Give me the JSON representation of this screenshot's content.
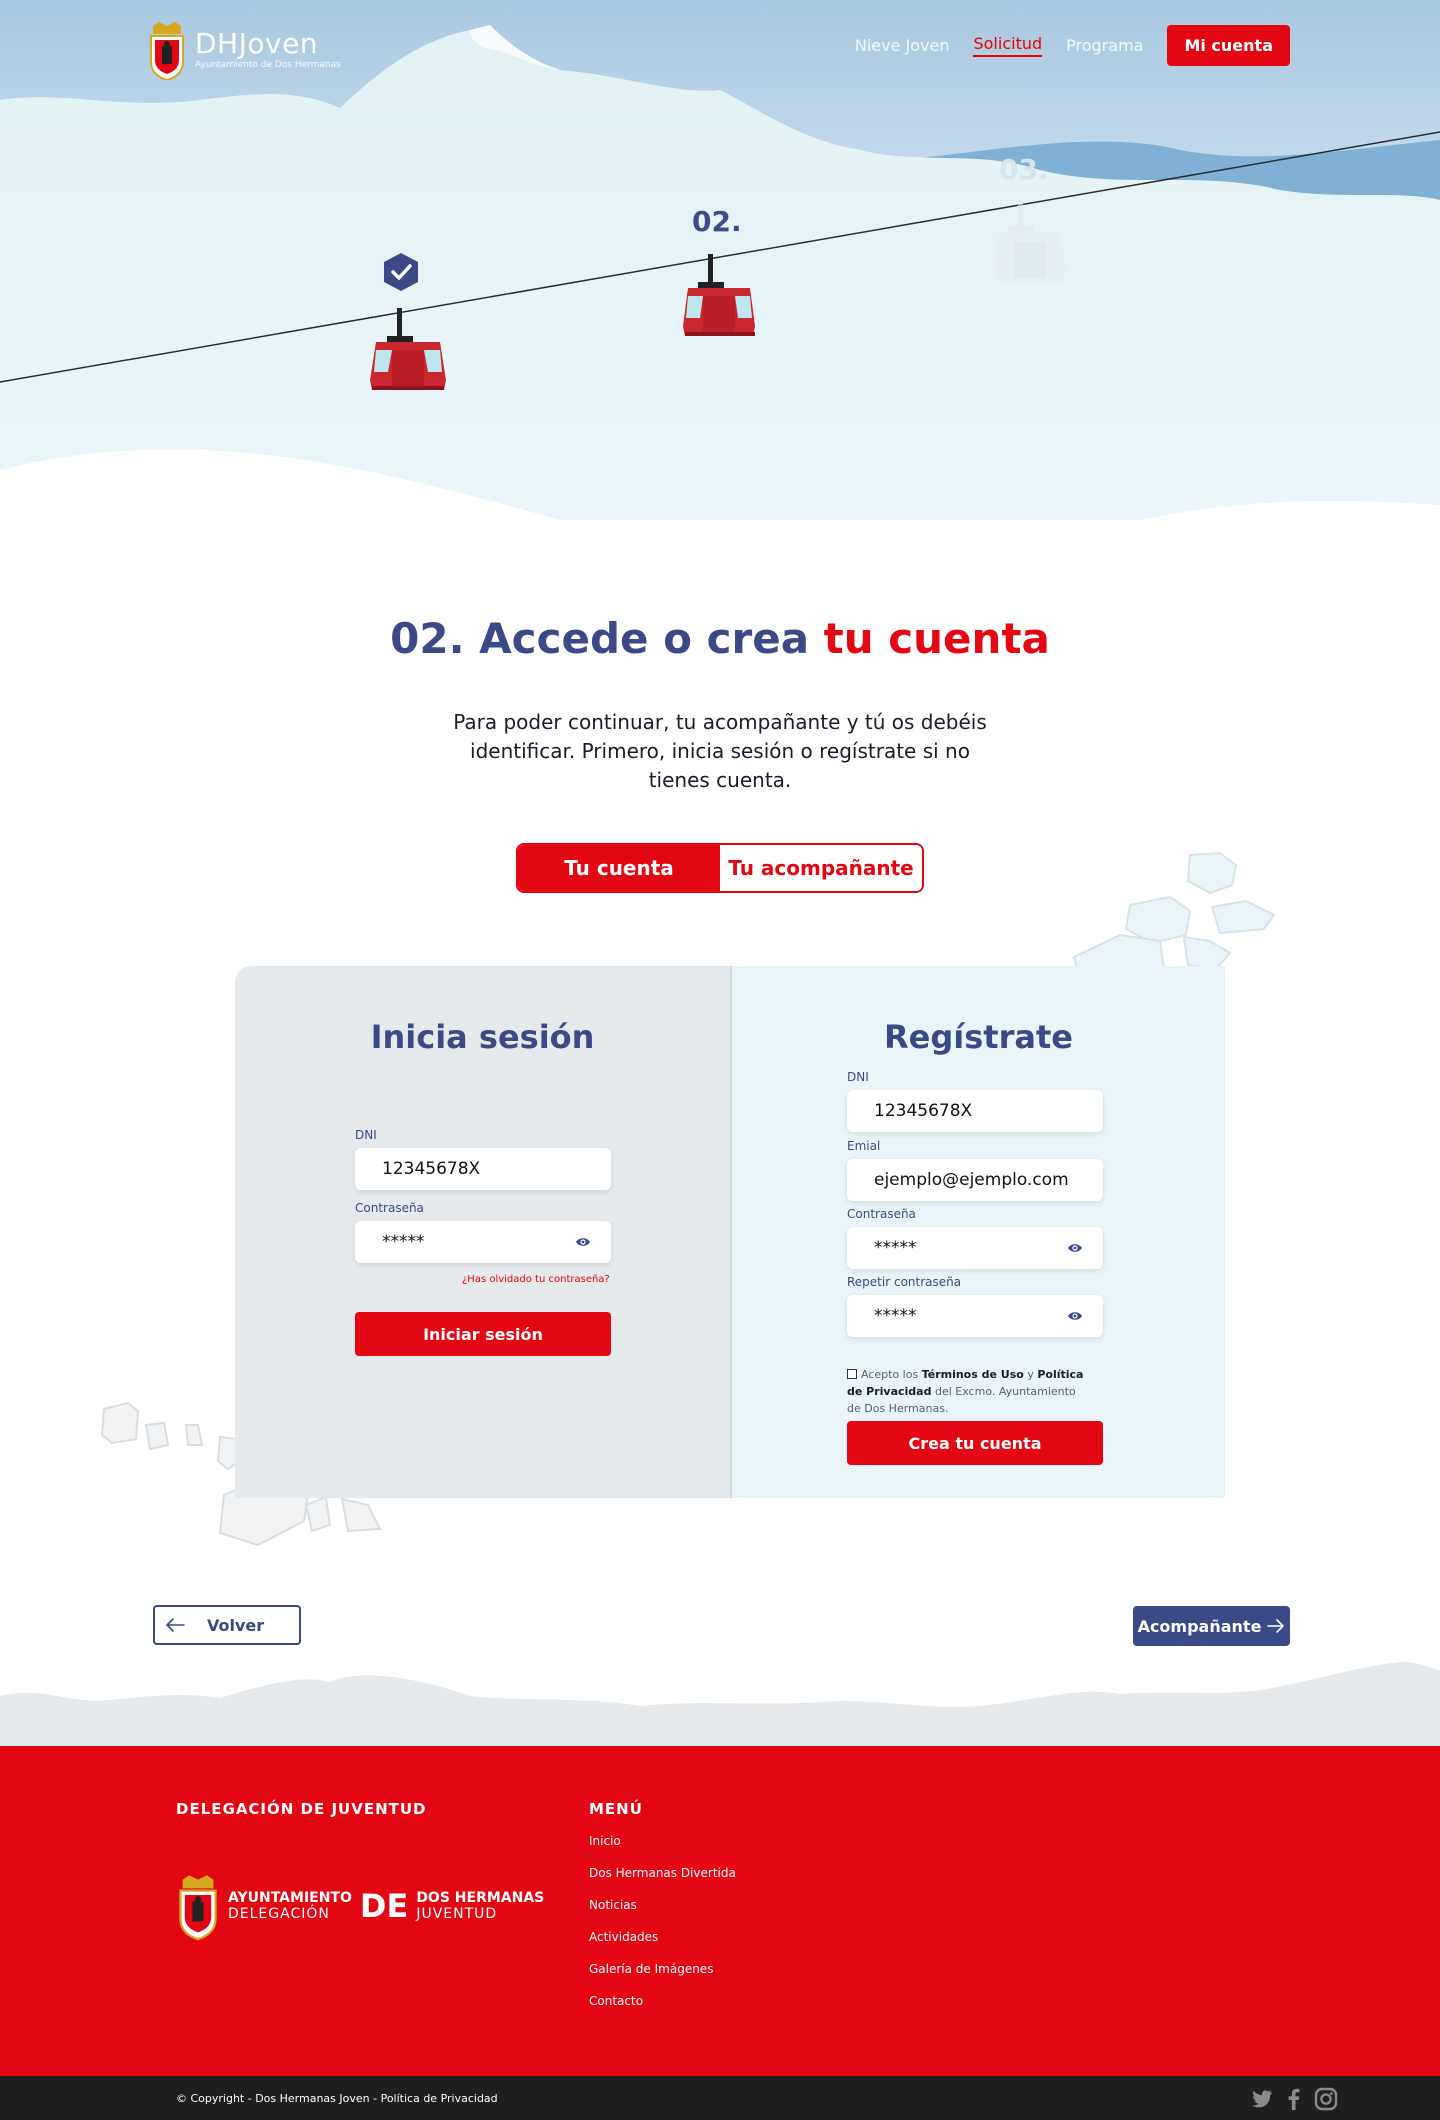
{
  "header": {
    "brand_name": "DHJoven",
    "brand_sub": "Ayuntamiento de Dos Hermanas",
    "nav": [
      {
        "label": "Nieve Joven"
      },
      {
        "label": "Solicitud"
      },
      {
        "label": "Programa"
      }
    ],
    "account_button": "Mi cuenta"
  },
  "steps": {
    "step2_label": "02.",
    "step3_label": "03."
  },
  "main": {
    "title_part1": "02. Accede o crea ",
    "title_part2": "tu cuenta",
    "intro": "Para poder continuar, tu acompañante y tú os debéis identificar. Primero, inicia sesión o regístrate si no tienes cuenta.",
    "tabs": [
      {
        "label": "Tu cuenta"
      },
      {
        "label": "Tu acompañante"
      }
    ]
  },
  "login": {
    "title": "Inicia sesión",
    "dni_label": "DNI",
    "dni_value": "12345678X",
    "password_label": "Contraseña",
    "password_value": "*****",
    "forgot": "¿Has olvidado tu contraseña?",
    "submit": "Iniciar sesión"
  },
  "register": {
    "title": "Regístrate",
    "dni_label": "DNI",
    "dni_value": "12345678X",
    "email_label": "Emial",
    "email_value": "ejemplo@ejemplo.com",
    "password_label": "Contraseña",
    "password_value": "*****",
    "repeat_label": "Repetir contraseña",
    "repeat_value": "*****",
    "terms_1": "Acepto los ",
    "terms_2": "Términos de Uso",
    "terms_3": " y ",
    "terms_4": "Política de Privacidad",
    "terms_5": " del Excmo. Ayuntamiento de Dos Hermanas.",
    "submit": "Crea tu cuenta"
  },
  "navigation": {
    "back": "Volver",
    "next": "Acompañante"
  },
  "footer": {
    "col1_title": "DELEGACIÓN DE JUVENTUD",
    "col2_title": "MENÚ",
    "logo_line1": "AYUNTAMIENTO",
    "logo_line2": "DELEGACIÓN",
    "logo_de": "DE",
    "logo_line3": "DOS HERMANAS",
    "logo_line4": "JUVENTUD",
    "menu": [
      "Inicio",
      "Dos Hermanas Divertida",
      "Noticias",
      "Actividades",
      "Galería de Imágenes",
      "Contacto"
    ],
    "copyright": "© Copyright - Dos Hermanas Joven - Política de Privacidad"
  },
  "colors": {
    "brand_red": "#e30613",
    "brand_blue": "#3b4a86"
  }
}
